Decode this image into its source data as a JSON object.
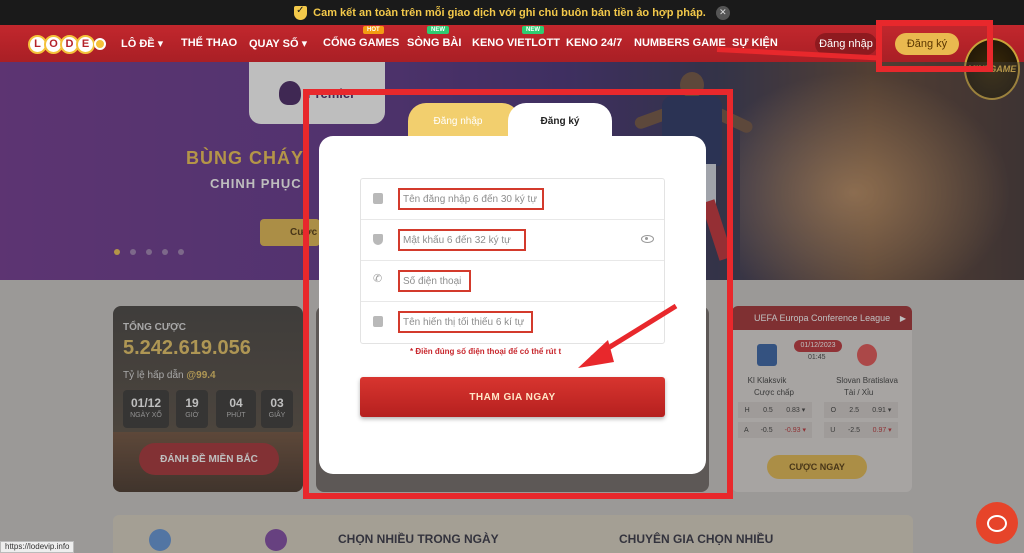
{
  "notice": {
    "text": "Cam kết an toàn trên mỗi giao dịch với ghi chú buôn bán tiền ảo hợp pháp.",
    "close": "✕"
  },
  "nav": {
    "logo_letters": [
      "L",
      "O",
      "D",
      "E"
    ],
    "items": [
      {
        "label": "LÔ ĐỀ ▾"
      },
      {
        "label": "THỂ THAO"
      },
      {
        "label": "QUAY SỐ ▾"
      },
      {
        "label": "CỔNG GAMES",
        "badge": "HOT"
      },
      {
        "label": "SÒNG BÀI",
        "badge": "NEW"
      },
      {
        "label": "KENO VIETLOTT",
        "badge": "NEW"
      },
      {
        "label": "KENO 24/7"
      },
      {
        "label": "NUMBERS GAME"
      },
      {
        "label": "SỰ KIỆN"
      }
    ],
    "login": "Đăng nhập",
    "register": "Đăng ký"
  },
  "hero": {
    "badge": "Premier",
    "title": "BÙNG CHÁY",
    "subtitle": "CHINH PHỤC",
    "button": "Cược",
    "minigame": "MINI GAME"
  },
  "stats": {
    "label": "TỔNG CƯỢC",
    "total": "5.242.619.056",
    "ratio_label": "Tỷ lệ hấp dẫn ",
    "ratio_value": "@99.4",
    "countdown": [
      {
        "value": "01/12",
        "unit": "NGÀY XỔ"
      },
      {
        "value": "19",
        "unit": "GIỜ"
      },
      {
        "value": "04",
        "unit": "PHÚT"
      },
      {
        "value": "03",
        "unit": "GIÂY"
      }
    ],
    "button": "ĐÁNH ĐỀ MIỀN BẮC"
  },
  "match": {
    "league": "UEFA Europa Conference League",
    "date": "01/12/2023",
    "time": "01:45",
    "home": "Kl Klaksvik",
    "away": "Slovan Bratislava",
    "handicap_label": "Cược chấp",
    "ou_label": "Tài / Xỉu",
    "odds": [
      {
        "side": "H",
        "line": "0.5",
        "price": "0.83 ▾"
      },
      {
        "side": "A",
        "line": "-0.5",
        "price": "-0.93 ▾"
      }
    ],
    "ou": [
      {
        "side": "O",
        "line": "2.5",
        "price": "0.91 ▾"
      },
      {
        "side": "U",
        "line": "-2.5",
        "price": "0.97 ▾"
      }
    ],
    "button": "CƯỢC NGAY"
  },
  "bottom": {
    "left_title": "CHỌN NHIỀU TRONG NGÀY",
    "right_title": "CHUYÊN GIA CHỌN NHIỀU"
  },
  "modal": {
    "tab_login": "Đăng nhập",
    "tab_register": "Đăng ký",
    "fields": {
      "username": "Tên đăng nhập 6 đến 30 ký tự",
      "password": "Mật khẩu 6 đến 32 ký tự",
      "phone": "Số điện thoại",
      "display_name": "Tên hiển thị tối thiểu 6 kí tự"
    },
    "note": "* Điền đúng số điện thoại để có thể rút t",
    "submit": "THAM GIA NGAY"
  },
  "status_url": "https://lodevip.info",
  "colors": {
    "brand_red": "#b5232a",
    "gold": "#e2b548",
    "highlight": "#e8282c"
  }
}
